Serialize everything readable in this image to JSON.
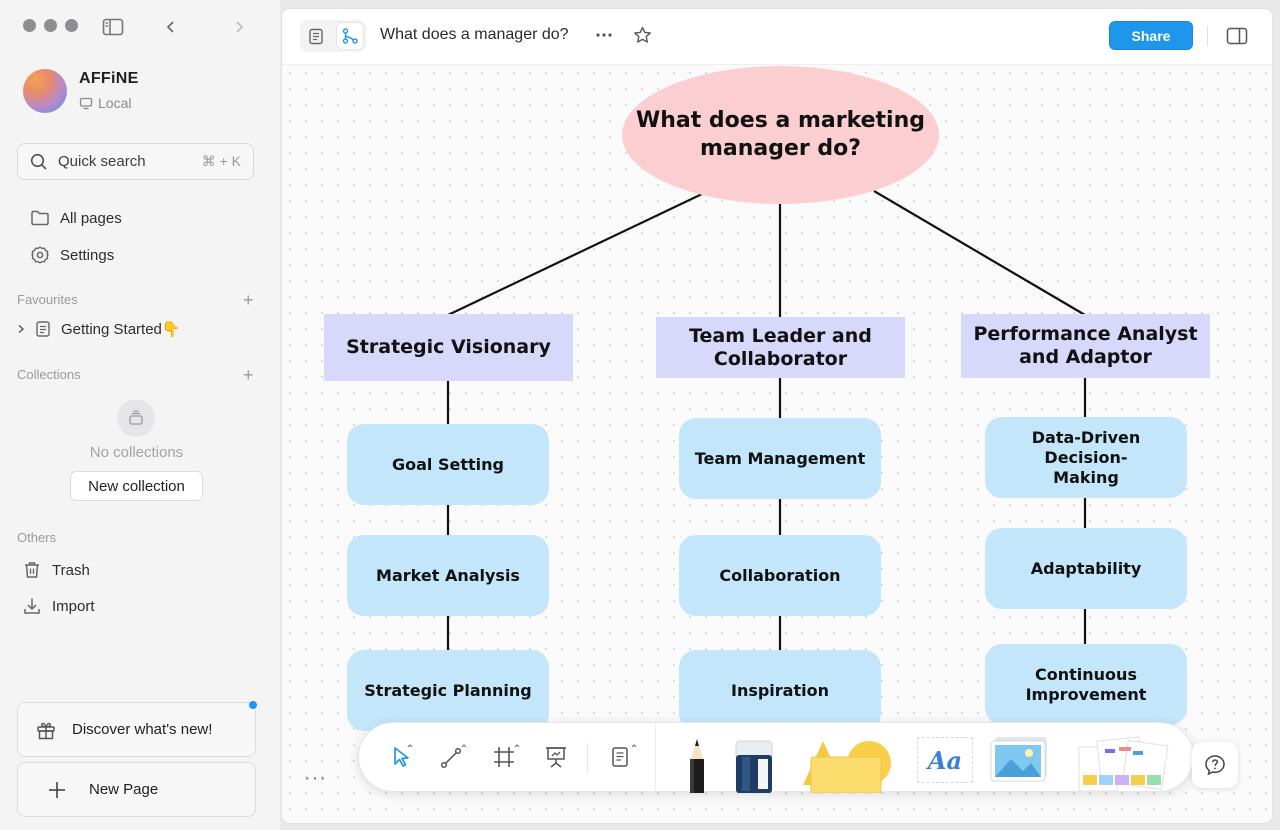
{
  "sidebar": {
    "workspace": {
      "name": "AFFiNE",
      "storage": "Local"
    },
    "search": {
      "label": "Quick search",
      "shortcut": "⌘ + K"
    },
    "nav": [
      {
        "label": "All pages",
        "icon": "folder-icon"
      },
      {
        "label": "Settings",
        "icon": "gear-icon"
      }
    ],
    "favourites": {
      "heading": "Favourites",
      "items": [
        {
          "label": "Getting Started👇",
          "icon": "page-icon"
        }
      ]
    },
    "collections": {
      "heading": "Collections",
      "empty_text": "No collections",
      "new_button": "New collection"
    },
    "others": {
      "heading": "Others",
      "items": [
        {
          "label": "Trash",
          "icon": "trash-icon"
        },
        {
          "label": "Import",
          "icon": "import-icon"
        }
      ]
    },
    "discover_label": "Discover what's new!",
    "new_page_label": "New Page"
  },
  "header": {
    "title": "What does a manager do?",
    "share_label": "Share",
    "mode": "edgeless"
  },
  "mindmap": {
    "root": "What does a marketing manager do?",
    "branches": [
      {
        "label": "Strategic Visionary",
        "children": [
          "Goal Setting",
          "Market Analysis",
          "Strategic Planning"
        ]
      },
      {
        "label": "Team Leader and Collaborator",
        "children": [
          "Team Management",
          "Collaboration",
          "Inspiration"
        ]
      },
      {
        "label": "Performance Analyst and Adaptor",
        "children": [
          "Data-Driven Decision-Making",
          "Adaptability",
          "Continuous Improvement"
        ]
      }
    ]
  },
  "toolbar": {
    "text_tool_label": "Aa",
    "tools": [
      "select-tool",
      "connector-tool",
      "frame-tool",
      "presentation-tool",
      "note-tool",
      "pen-tool",
      "eraser-tool",
      "shape-tool",
      "text-tool",
      "image-tool",
      "template-tool"
    ]
  },
  "colors": {
    "accent": "#1e96eb",
    "root_fill": "#fbcfd2",
    "branch_fill": "#d8d8fb",
    "leaf_fill": "#c4e6fb"
  }
}
